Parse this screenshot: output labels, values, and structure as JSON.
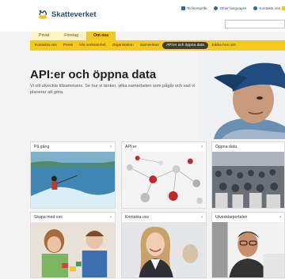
{
  "header": {
    "brand": "Skatteverket",
    "tools": [
      {
        "icon": "sign-language-icon",
        "label": "Teckenspråk"
      },
      {
        "icon": "globe-icon",
        "label": "Other languages"
      },
      {
        "icon": "phone-icon",
        "label": "Kontakta oss"
      }
    ]
  },
  "segment_tabs": [
    {
      "label": "Privat",
      "active": false
    },
    {
      "label": "Företag",
      "active": false
    },
    {
      "label": "Om oss",
      "active": true
    }
  ],
  "nav": [
    {
      "label": "Kontakta oss",
      "active": false
    },
    {
      "label": "Press",
      "active": false
    },
    {
      "label": "Vår verksamhet",
      "active": false
    },
    {
      "label": "Organisation",
      "active": false
    },
    {
      "label": "Samverkan",
      "active": false
    },
    {
      "label": "API:er och öppna data",
      "active": true
    },
    {
      "label": "Jobba hos oss",
      "active": false
    }
  ],
  "hero": {
    "title": "API:er och öppna data",
    "text": "Vi vill utveckla tillsammans. Se hur vi tänker, vilka samarbeten som pågår och vad vi planerar att göra."
  },
  "cards": [
    {
      "label": "På gång",
      "image": "water-skier-photo"
    },
    {
      "label": "API:er",
      "image": "molecule-spheres-photo"
    },
    {
      "label": "Öppna data",
      "image": "crowd-photo"
    },
    {
      "label": "Skapa med oss",
      "image": "children-building-photo"
    },
    {
      "label": "Kontakta oss",
      "image": "smiling-woman-photo"
    },
    {
      "label": "Utvecklarportalen",
      "image": "developer-photo"
    }
  ],
  "colors": {
    "accent": "#f5c81e",
    "accent_light": "#fdf3c5",
    "brand_text": "#2d4f6e",
    "link": "#29567a"
  }
}
